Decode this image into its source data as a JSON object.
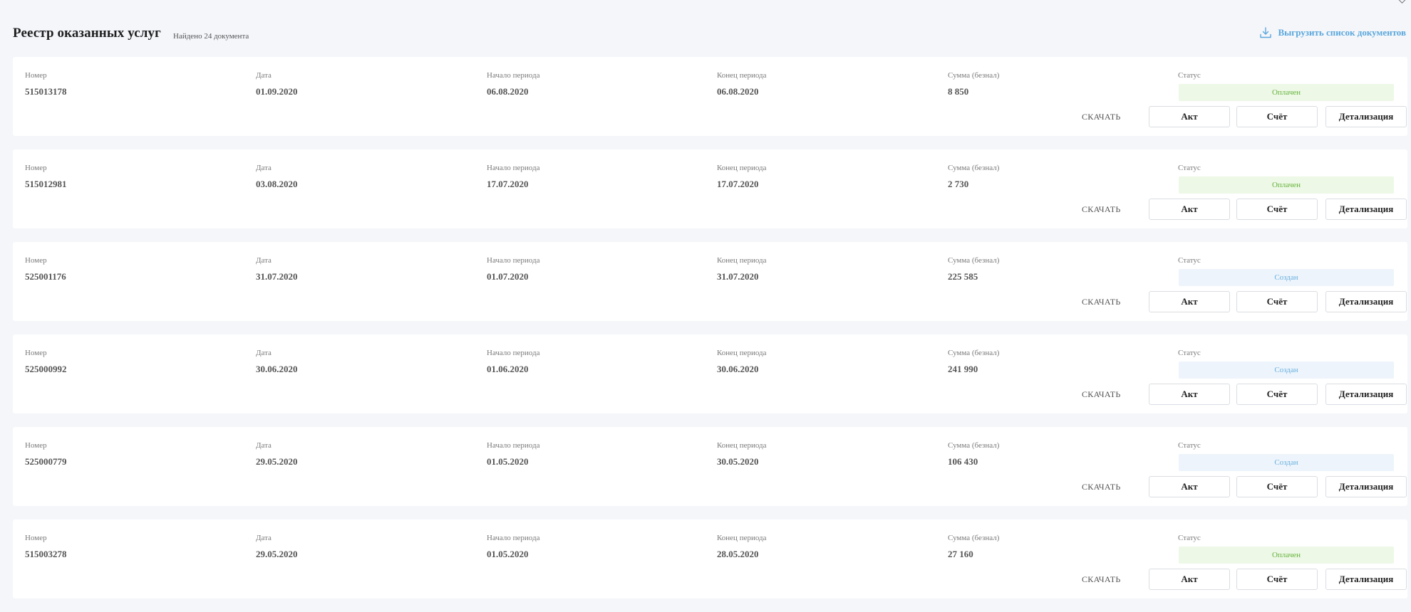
{
  "header": {
    "title": "Реестр оказанных услуг",
    "found_count": "Найдено 24 документа",
    "export_label": "Выгрузить список документов"
  },
  "labels": {
    "number": "Номер",
    "date": "Дата",
    "period_start": "Начало периода",
    "period_end": "Конец периода",
    "sum": "Сумма (безнал)",
    "status": "Статус",
    "download": "СКАЧАТЬ",
    "act": "Акт",
    "invoice": "Счёт",
    "details": "Детализация"
  },
  "colors": {
    "paid_bg": "#edf8e6",
    "paid_text": "#66b33e",
    "created_bg": "#edf4fb",
    "created_text": "#6ab1e0",
    "accent": "#5aa7dc"
  },
  "documents": [
    {
      "number": "515013178",
      "date": "01.09.2020",
      "start": "06.08.2020",
      "end": "06.08.2020",
      "sum": "8 850",
      "status": "Оплачен",
      "status_type": "paid"
    },
    {
      "number": "515012981",
      "date": "03.08.2020",
      "start": "17.07.2020",
      "end": "17.07.2020",
      "sum": "2 730",
      "status": "Оплачен",
      "status_type": "paid"
    },
    {
      "number": "525001176",
      "date": "31.07.2020",
      "start": "01.07.2020",
      "end": "31.07.2020",
      "sum": "225 585",
      "status": "Создан",
      "status_type": "created"
    },
    {
      "number": "525000992",
      "date": "30.06.2020",
      "start": "01.06.2020",
      "end": "30.06.2020",
      "sum": "241 990",
      "status": "Создан",
      "status_type": "created"
    },
    {
      "number": "525000779",
      "date": "29.05.2020",
      "start": "01.05.2020",
      "end": "30.05.2020",
      "sum": "106 430",
      "status": "Создан",
      "status_type": "created"
    },
    {
      "number": "515003278",
      "date": "29.05.2020",
      "start": "01.05.2020",
      "end": "28.05.2020",
      "sum": "27 160",
      "status": "Оплачен",
      "status_type": "paid"
    }
  ]
}
